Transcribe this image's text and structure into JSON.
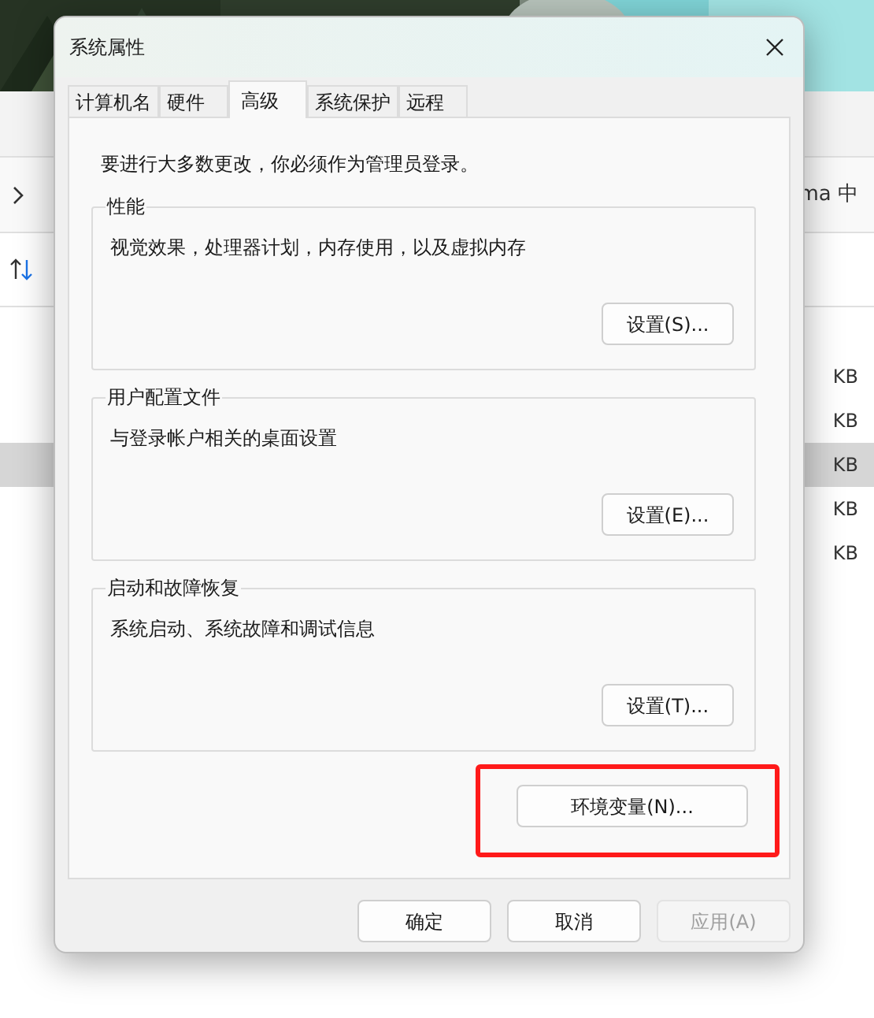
{
  "background": {
    "address_text": "ma 中",
    "file_rows": [
      {
        "size": "KB",
        "selected": false
      },
      {
        "size": "KB",
        "selected": false
      },
      {
        "size": "KB",
        "selected": true
      },
      {
        "size": "KB",
        "selected": false
      },
      {
        "size": "KB",
        "selected": false
      }
    ]
  },
  "dialog": {
    "title": "系统属性",
    "tabs": [
      {
        "label": "计算机名",
        "selected": false
      },
      {
        "label": "硬件",
        "selected": false
      },
      {
        "label": "高级",
        "selected": true
      },
      {
        "label": "系统保护",
        "selected": false
      },
      {
        "label": "远程",
        "selected": false
      }
    ],
    "note": "要进行大多数更改，你必须作为管理员登录。",
    "groups": [
      {
        "title": "性能",
        "description": "视觉效果，处理器计划，内存使用，以及虚拟内存",
        "button": "设置(S)..."
      },
      {
        "title": "用户配置文件",
        "description": "与登录帐户相关的桌面设置",
        "button": "设置(E)..."
      },
      {
        "title": "启动和故障恢复",
        "description": "系统启动、系统故障和调试信息",
        "button": "设置(T)..."
      }
    ],
    "env_button": {
      "label": "环境变量(N)...",
      "highlighted": true
    },
    "buttons": [
      {
        "label": "确定",
        "disabled": false
      },
      {
        "label": "取消",
        "disabled": false
      },
      {
        "label": "应用(A)",
        "disabled": true
      }
    ]
  }
}
